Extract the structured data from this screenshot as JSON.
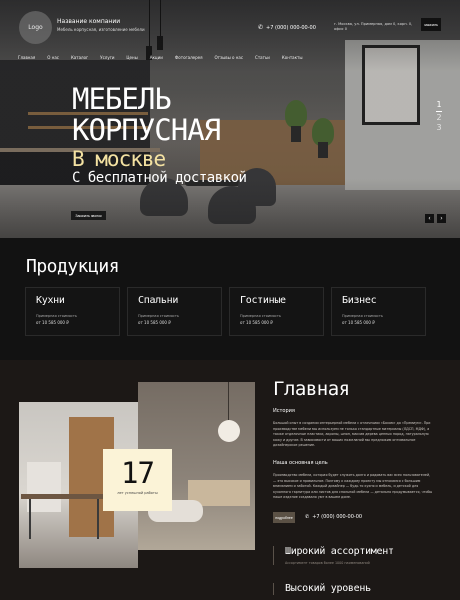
{
  "header": {
    "logo": "Logo",
    "company_name": "Название компании",
    "slogan": "Мебель корпусная, изготовление мебели",
    "phone": "+7 (000) 000-00-00",
    "address": "г. Москва, ул. Примерная, дом 0, корп. 0, офис 0",
    "request_button": "заказать"
  },
  "nav": [
    "Главная",
    "О нас",
    "Каталог",
    "Услуги",
    "Цены",
    "Акции",
    "Фотогалерея",
    "Отзывы о нас",
    "Статьи",
    "Контакты"
  ],
  "hero": {
    "line1": "МЕБЕЛЬ",
    "line2": "КОРПУСНАЯ",
    "line3": "В москве",
    "line4": "С бесплатной доставкой",
    "order_button": "Заказать звонок",
    "slides": [
      "1",
      "2",
      "3"
    ],
    "prev": "‹",
    "next": "›"
  },
  "products": {
    "title": "Продукция",
    "items": [
      {
        "name": "Кухни",
        "label": "Примерная стоимость",
        "price": "от 10 585 000 ₽"
      },
      {
        "name": "Спальни",
        "label": "Примерная стоимость",
        "price": "от 10 585 000 ₽"
      },
      {
        "name": "Гостиные",
        "label": "Примерная стоимость",
        "price": "от 10 585 000 ₽"
      },
      {
        "name": "Бизнес",
        "label": "Примерная стоимость",
        "price": "от 10 585 000 ₽"
      }
    ]
  },
  "main": {
    "title": "Главная",
    "history_title": "История",
    "history_text": "Большой опыт в создании интерьерной мебели с отличными «Бохом» до «Премиум». При производстве мебели мы используем не только стандартные материалы (ЛДСП, МДФ), а также отделочные пластики, акрилы, шпон, массив дерева ценных пород, натуральную кожу и другие. В зависимости от ваших пожеланий мы предложим оптимальное дизайнерское решение.",
    "goal_title": "Наша основная цель",
    "goal_text": "Производство мебели, которая будет служить долго и радовать вас всех пользователей, — это высокое и правильное. Поэтому к каждому проекту мы относимся с большим вниманием и заботой. Каждый дизайнер — будь то кухня и мебель, и детской для кухонного гарнитура или листов для спальной мебели — детально продумывается, чтобы наше изделие создавало уют в вашем доме.",
    "more_button": "подробнее",
    "phone": "+7 (000) 000-00-00",
    "stat_number": "17",
    "stat_label": "лет успешной работы",
    "features": [
      {
        "title": "Широкий ассортимент",
        "desc": "Ассортимент товаров более 1000 наименований"
      },
      {
        "title": "Высокий уровень",
        "desc": ""
      }
    ]
  },
  "colors": {
    "accent": "#fbf3d7",
    "hero_subtitle": "#f4e2a2",
    "background": "#1c1816"
  }
}
